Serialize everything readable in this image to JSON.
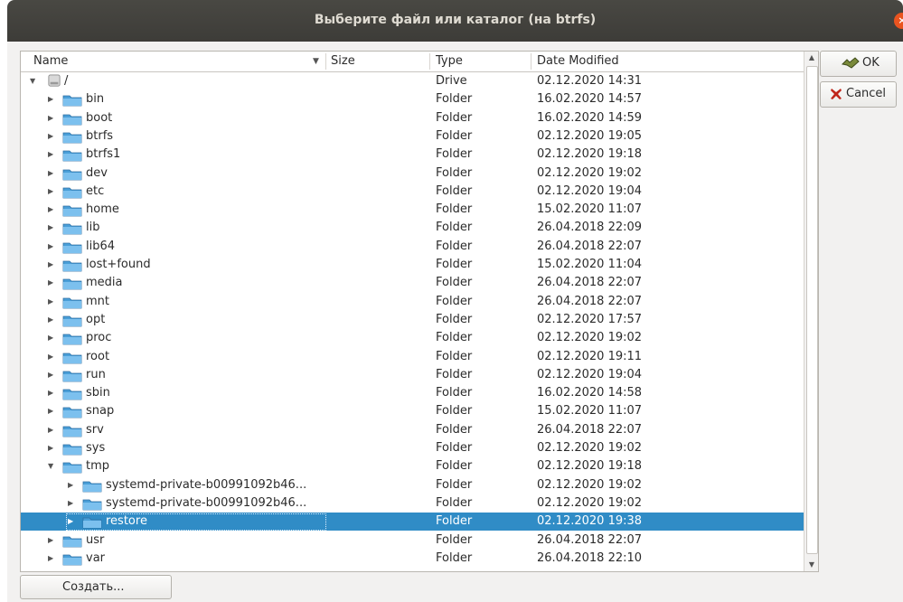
{
  "window": {
    "title": "Выберите файл или каталог (на btrfs)",
    "close_glyph": "×"
  },
  "columns": {
    "name": "Name",
    "size": "Size",
    "type": "Type",
    "date": "Date Modified"
  },
  "buttons": {
    "ok": "OK",
    "cancel": "Cancel",
    "create": "Создать..."
  },
  "colors": {
    "accent": "#308cc6",
    "folder": "#4a9fd8",
    "titlebar": "#3d3c38",
    "close": "#e95420"
  },
  "rows": [
    {
      "name": "/",
      "type": "Drive",
      "date": "02.12.2020 14:31",
      "icon": "drive-icon",
      "expanded": true,
      "depth": 0
    },
    {
      "name": "bin",
      "type": "Folder",
      "date": "16.02.2020 14:57",
      "icon": "folder-icon",
      "depth": 1
    },
    {
      "name": "boot",
      "type": "Folder",
      "date": "16.02.2020 14:59",
      "icon": "folder-icon",
      "depth": 1
    },
    {
      "name": "btrfs",
      "type": "Folder",
      "date": "02.12.2020 19:05",
      "icon": "folder-icon",
      "depth": 1
    },
    {
      "name": "btrfs1",
      "type": "Folder",
      "date": "02.12.2020 19:18",
      "icon": "folder-icon",
      "depth": 1
    },
    {
      "name": "dev",
      "type": "Folder",
      "date": "02.12.2020 19:02",
      "icon": "folder-icon",
      "depth": 1
    },
    {
      "name": "etc",
      "type": "Folder",
      "date": "02.12.2020 19:04",
      "icon": "folder-icon",
      "depth": 1
    },
    {
      "name": "home",
      "type": "Folder",
      "date": "15.02.2020 11:07",
      "icon": "folder-icon",
      "depth": 1
    },
    {
      "name": "lib",
      "type": "Folder",
      "date": "26.04.2018 22:09",
      "icon": "folder-icon",
      "depth": 1
    },
    {
      "name": "lib64",
      "type": "Folder",
      "date": "26.04.2018 22:07",
      "icon": "folder-icon",
      "depth": 1
    },
    {
      "name": "lost+found",
      "type": "Folder",
      "date": "15.02.2020 11:04",
      "icon": "folder-icon",
      "depth": 1
    },
    {
      "name": "media",
      "type": "Folder",
      "date": "26.04.2018 22:07",
      "icon": "folder-icon",
      "depth": 1
    },
    {
      "name": "mnt",
      "type": "Folder",
      "date": "26.04.2018 22:07",
      "icon": "folder-icon",
      "depth": 1
    },
    {
      "name": "opt",
      "type": "Folder",
      "date": "02.12.2020 17:57",
      "icon": "folder-icon",
      "depth": 1
    },
    {
      "name": "proc",
      "type": "Folder",
      "date": "02.12.2020 19:02",
      "icon": "folder-icon",
      "depth": 1
    },
    {
      "name": "root",
      "type": "Folder",
      "date": "02.12.2020 19:11",
      "icon": "folder-icon",
      "depth": 1
    },
    {
      "name": "run",
      "type": "Folder",
      "date": "02.12.2020 19:04",
      "icon": "folder-icon",
      "depth": 1
    },
    {
      "name": "sbin",
      "type": "Folder",
      "date": "16.02.2020 14:58",
      "icon": "folder-icon",
      "depth": 1
    },
    {
      "name": "snap",
      "type": "Folder",
      "date": "15.02.2020 11:07",
      "icon": "folder-icon",
      "depth": 1
    },
    {
      "name": "srv",
      "type": "Folder",
      "date": "26.04.2018 22:07",
      "icon": "folder-icon",
      "depth": 1
    },
    {
      "name": "sys",
      "type": "Folder",
      "date": "02.12.2020 19:02",
      "icon": "folder-icon",
      "depth": 1
    },
    {
      "name": "tmp",
      "type": "Folder",
      "date": "02.12.2020 19:18",
      "icon": "folder-icon",
      "expanded": true,
      "depth": 1
    },
    {
      "name": "systemd-private-b00991092b46...",
      "type": "Folder",
      "date": "02.12.2020 19:02",
      "icon": "folder-icon",
      "depth": 2
    },
    {
      "name": "systemd-private-b00991092b46...",
      "type": "Folder",
      "date": "02.12.2020 19:02",
      "icon": "folder-icon",
      "depth": 2
    },
    {
      "name": "restore",
      "type": "Folder",
      "date": "02.12.2020 19:38",
      "icon": "folder-icon",
      "depth": 2,
      "selected": true
    },
    {
      "name": "usr",
      "type": "Folder",
      "date": "26.04.2018 22:07",
      "icon": "folder-icon",
      "depth": 1
    },
    {
      "name": "var",
      "type": "Folder",
      "date": "26.04.2018 22:10",
      "icon": "folder-icon",
      "depth": 1
    }
  ]
}
